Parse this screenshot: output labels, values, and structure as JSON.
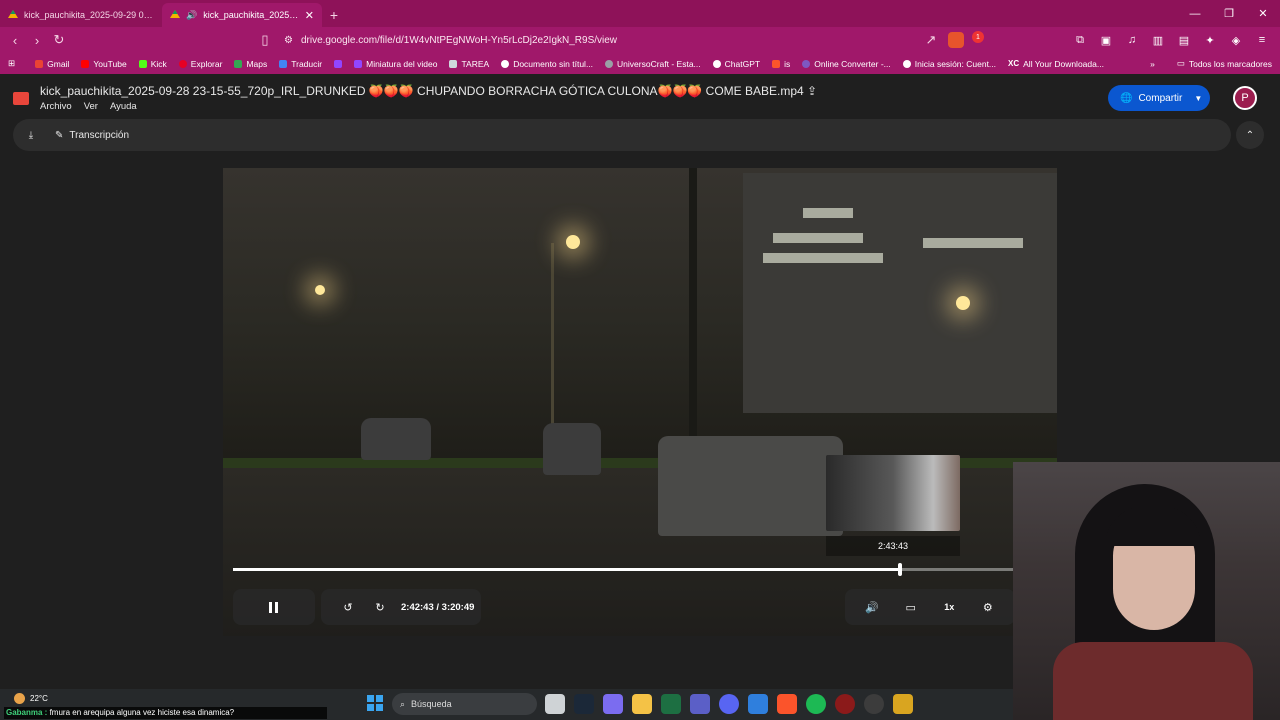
{
  "browser": {
    "tabs": [
      {
        "title": "kick_pauchikita_2025-09-29 06-47-4",
        "active": false
      },
      {
        "title": "kick_pauchikita_2025-09-28 2",
        "active": true
      }
    ],
    "new_tab": "+",
    "window_controls": {
      "minimize": "—",
      "restore": "❐",
      "close": "✕"
    },
    "url": "drive.google.com/file/d/1W4vNtPEgNWoH-Yn5rLcDj2e2IgkN_R9S/view",
    "notification_count": "1",
    "bookmarks": [
      "Gmail",
      "YouTube",
      "Kick",
      "Explorar",
      "Maps",
      "Traducir",
      "",
      "Miniatura del video",
      "TAREA",
      "Documento sin títul...",
      "UniversoCraft - Esta...",
      "ChatGPT",
      "is",
      "Online Converter -...",
      "Inicia sesión: Cuent...",
      "All Your Downloada..."
    ],
    "bookmarks_overflow": "»",
    "all_bookmarks": "Todos los marcadores"
  },
  "drive": {
    "file_name": "kick_pauchikita_2025-09-28 23-15-55_720p_IRL_DRUNKED 🍑🍑🍑 CHUPANDO BORRACHA GÓTICA CULONA🍑🍑🍑 COME BABE.mp4",
    "menu": [
      "Archivo",
      "Ver",
      "Ayuda"
    ],
    "share_label": "Compartir",
    "avatar_letter": "P",
    "transcript_label": "Transcripción"
  },
  "player": {
    "preview_time": "2:43:43",
    "current_time": "2:42:43",
    "total_time": "/ 3:20:49",
    "progress": 0.81,
    "speed": "1x"
  },
  "taskbar": {
    "temperature": "22°C",
    "search_placeholder": "Búsqueda"
  },
  "chat": {
    "user": "Gabanma :",
    "message": " fmura en arequipa alguna vez hiciste esa dinamica?"
  }
}
